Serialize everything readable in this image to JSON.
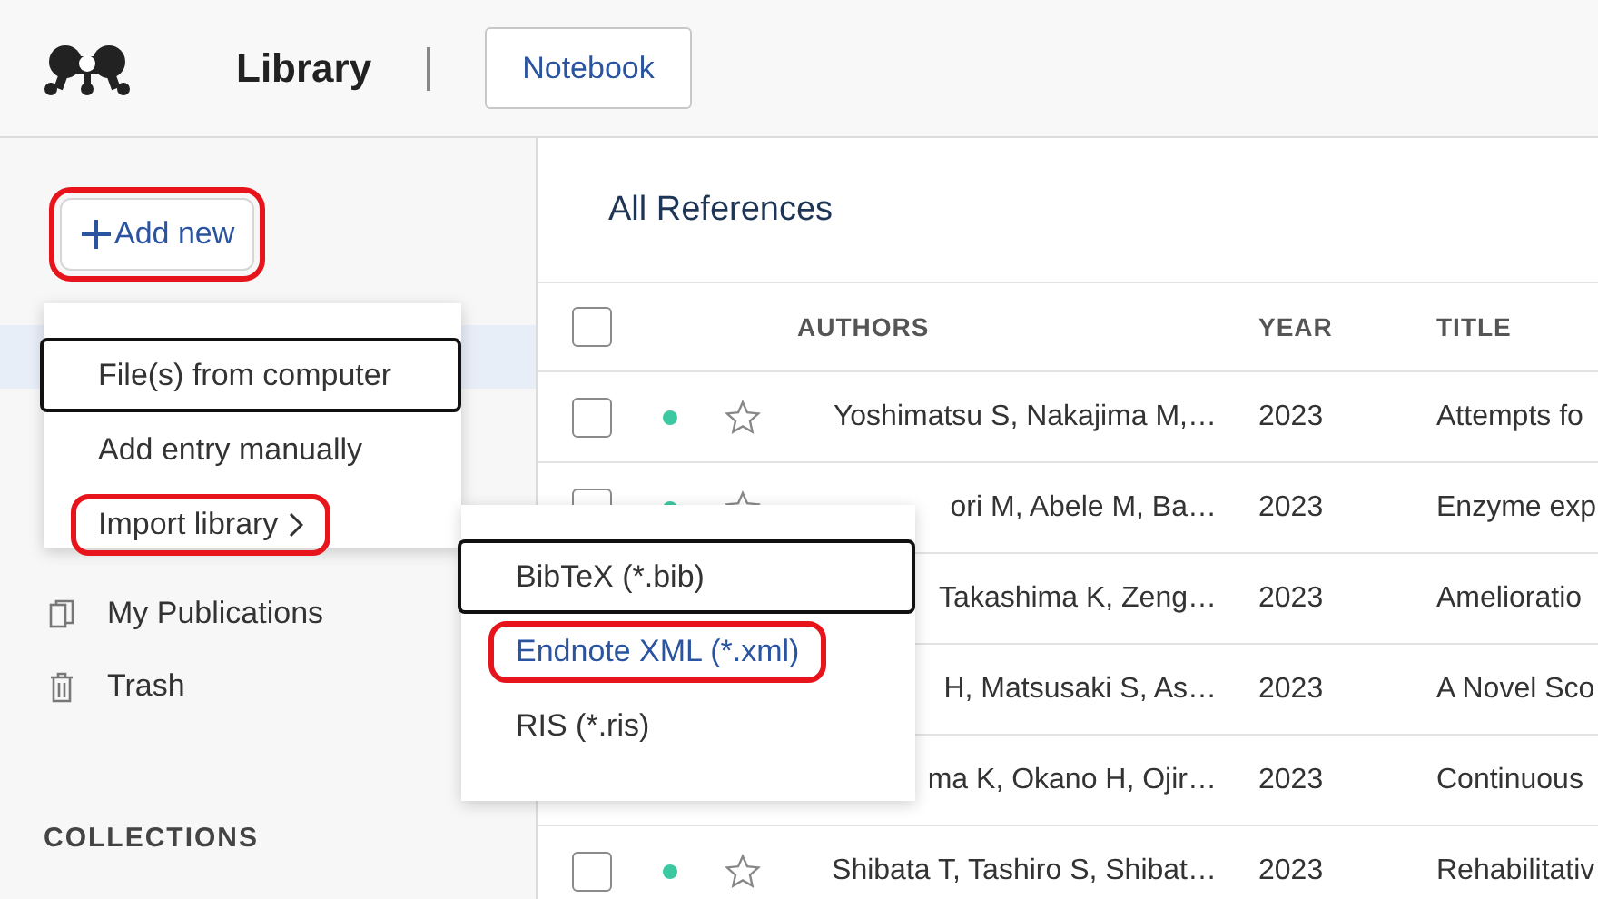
{
  "header": {
    "title": "Library",
    "notebook_button": "Notebook"
  },
  "sidebar": {
    "add_button": {
      "label": "Add new",
      "highlighted": true
    },
    "items": [
      {
        "label": "My Publications",
        "kind": "publications"
      },
      {
        "label": "Trash",
        "kind": "trash"
      }
    ],
    "section_title": "COLLECTIONS"
  },
  "add_menu": {
    "items": [
      {
        "label": "File(s) from computer",
        "focused": true,
        "highlighted": false,
        "hovered": false,
        "submenu": false
      },
      {
        "label": "Add entry manually",
        "focused": false,
        "highlighted": false,
        "hovered": false,
        "submenu": false
      },
      {
        "label": "Import library",
        "focused": false,
        "highlighted": true,
        "hovered": false,
        "submenu": true
      }
    ]
  },
  "import_submenu": {
    "items": [
      {
        "label": "BibTeX (*.bib)",
        "focused": true,
        "highlighted": false,
        "hovered": false,
        "submenu": false
      },
      {
        "label": "Endnote XML (*.xml)",
        "focused": false,
        "highlighted": true,
        "hovered": true,
        "submenu": false
      },
      {
        "label": "RIS (*.ris)",
        "focused": false,
        "highlighted": false,
        "hovered": false,
        "submenu": false
      }
    ]
  },
  "main": {
    "title": "All References",
    "select_all": {
      "checked": false
    },
    "columns": [
      "AUTHORS",
      "YEAR",
      "TITLE"
    ],
    "rows": [
      {
        "checked": false,
        "unread": true,
        "starred": false,
        "authors": "Yoshimatsu S, Nakajima M,…",
        "year": "2023",
        "title": "Attempts fo"
      },
      {
        "checked": false,
        "unread": true,
        "starred": false,
        "authors": "ori M, Abele M, Ba…",
        "year": "2023",
        "title": "Enzyme exp"
      },
      {
        "authors": "Takashima K, Zeng…",
        "year": "2023",
        "title": "Amelioratio"
      },
      {
        "authors": "H, Matsusaki S, As…",
        "year": "2023",
        "title": "A Novel Sco"
      },
      {
        "authors": "ma K, Okano H, Ojir…",
        "year": "2023",
        "title": "Continuous"
      },
      {
        "checked": false,
        "unread": true,
        "starred": false,
        "authors": "Shibata T, Tashiro S, Shibat…",
        "year": "2023",
        "title": "Rehabilitativ"
      }
    ]
  }
}
